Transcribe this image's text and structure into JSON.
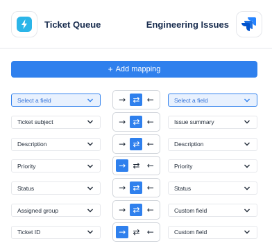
{
  "header": {
    "left_app": {
      "title": "Ticket Queue",
      "icon": "lightning-icon"
    },
    "right_app": {
      "title": "Engineering Issues",
      "icon": "jira-icon"
    }
  },
  "add_button": {
    "plus": "+",
    "label": "Add mapping"
  },
  "direction_glyphs": {
    "right": "→",
    "both": "⇄",
    "left": "←"
  },
  "mappings": [
    {
      "left": "Select a field",
      "right": "Select a field",
      "direction": "both",
      "placeholder": true
    },
    {
      "left": "Ticket subject",
      "right": "Issue summary",
      "direction": "both",
      "placeholder": false
    },
    {
      "left": "Description",
      "right": "Description",
      "direction": "both",
      "placeholder": false
    },
    {
      "left": "Priority",
      "right": "Priority",
      "direction": "right",
      "placeholder": false
    },
    {
      "left": "Status",
      "right": "Status",
      "direction": "both",
      "placeholder": false
    },
    {
      "left": "Assigned group",
      "right": "Custom field",
      "direction": "both",
      "placeholder": false
    },
    {
      "left": "Ticket ID",
      "right": "Custom field",
      "direction": "right",
      "placeholder": false
    }
  ],
  "colors": {
    "accent": "#2f80ed",
    "title": "#172b4d"
  }
}
